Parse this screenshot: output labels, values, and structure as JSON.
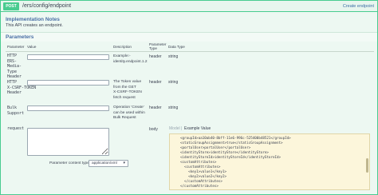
{
  "operation": {
    "method": "POST",
    "path": "/ers/config/endpoint",
    "summary": "Create endpoint"
  },
  "implementation": {
    "title": "Implementation Notes",
    "text": "This API creates an endpoint."
  },
  "parameters": {
    "title": "Parameters",
    "columns": [
      "Parameter",
      "Value",
      "Description",
      "Parameter Type",
      "Data Type"
    ],
    "rows": [
      {
        "name_lines": [
          "HTTP",
          "ERS-",
          "Media-",
          "Type",
          "Header"
        ],
        "description_lines": [
          "Example:-",
          "identity.endpoint.1.2"
        ],
        "param_type": "header",
        "data_type": "string",
        "value": ""
      },
      {
        "name_lines": [
          "HTTP",
          "X-CSRF-TOKEN",
          "Header"
        ],
        "description_lines": [
          "The Token value",
          "from the GET",
          "X-CSRF-TOKEN",
          "fetch request"
        ],
        "param_type": "header",
        "data_type": "string",
        "value": ""
      },
      {
        "name_lines": [
          "Bulk",
          "Support"
        ],
        "description_lines": [
          "Operation 'Create'",
          "can be used within",
          "Bulk Request"
        ],
        "param_type": "header",
        "data_type": "string",
        "value": ""
      },
      {
        "name_lines": [
          "request"
        ],
        "description_lines": [],
        "param_type": "body",
        "data_type": "",
        "value": ""
      }
    ]
  },
  "body": {
    "content_type_label": "Parameter content type:",
    "content_type_value": "application/xml",
    "tab_model": "Model",
    "tab_sep": "|",
    "tab_example": "Example Value",
    "example_lines": [
      "<groupId>aa10ab40-8bff-11e6-996c-525400b48521</groupId>",
      "<staticGroupAssignment>true</staticGroupAssignment>",
      "<portalUser>portalUser</portalUser>",
      "<identityStore>identityStore</identityStore>",
      "<identityStoreId>identityStoreId</identityStoreId>",
      "<customAttributes>",
      "  <customAttributes>",
      "    <key1>value1</key1>",
      "    <key2>value2</key2>",
      "  </customAttributes>",
      "</customAttributes>"
    ]
  },
  "colors": {
    "post_green": "#49cc90",
    "link_blue": "#3b6ea5",
    "example_bg": "#fcf6db"
  }
}
